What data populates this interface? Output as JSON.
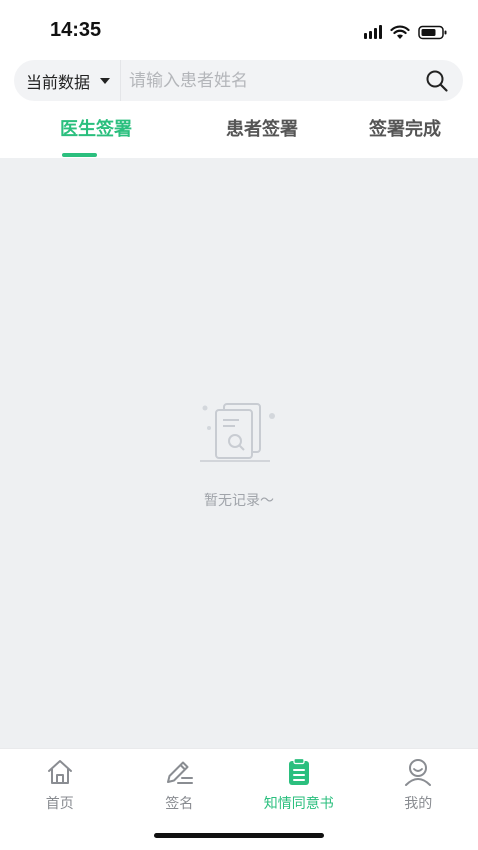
{
  "status_bar": {
    "time": "14:35"
  },
  "search": {
    "filter_label": "当前数据",
    "placeholder": "请输入患者姓名",
    "value": ""
  },
  "tabs": [
    {
      "label": "医生签署",
      "active": true
    },
    {
      "label": "患者签署",
      "active": false
    },
    {
      "label": "签署完成",
      "active": false
    }
  ],
  "empty_state": {
    "text": "暂无记录～"
  },
  "bottom_nav": [
    {
      "label": "首页",
      "icon": "home-icon",
      "active": false
    },
    {
      "label": "签名",
      "icon": "pen-icon",
      "active": false
    },
    {
      "label": "知情同意书",
      "icon": "clipboard-icon",
      "active": true
    },
    {
      "label": "我的",
      "icon": "profile-icon",
      "active": false
    }
  ],
  "colors": {
    "accent": "#2bbf7e",
    "background": "#eef0f2",
    "inactive_text": "#888b90"
  }
}
